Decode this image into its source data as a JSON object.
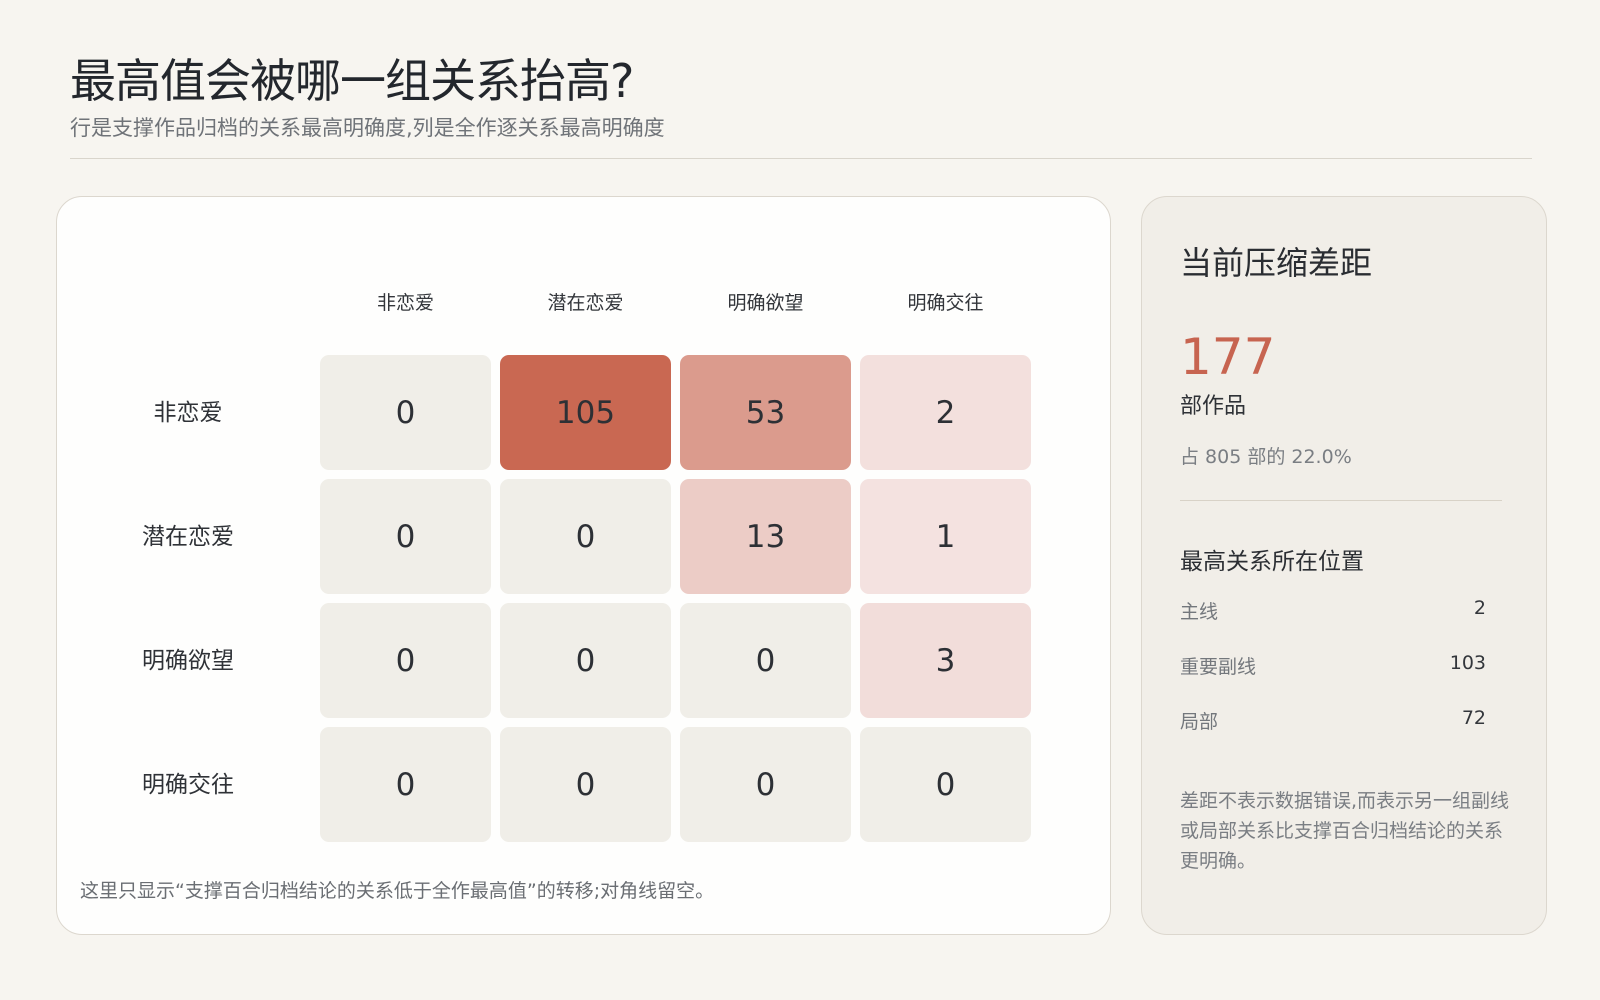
{
  "header": {
    "title": "最高值会被哪一组关系抬高?",
    "subtitle": "行是支撑作品归档的关系最高明确度,列是全作逐关系最高明确度"
  },
  "chart_data": {
    "type": "heatmap",
    "rows": [
      "非恋爱",
      "潜在恋爱",
      "明确欲望",
      "明确交往"
    ],
    "columns": [
      "非恋爱",
      "潜在恋爱",
      "明确欲望",
      "明确交往"
    ],
    "values": [
      [
        0,
        105,
        53,
        2
      ],
      [
        0,
        0,
        13,
        1
      ],
      [
        0,
        0,
        0,
        3
      ],
      [
        0,
        0,
        0,
        0
      ]
    ],
    "color_scale": {
      "zero": "#f0eee8",
      "low": "#f5e6e4",
      "high": "#c96852"
    },
    "max_value": 105
  },
  "footnote": "这里只显示“支撑百合归档结论的关系低于全作最高值”的转移;对角线留空。",
  "side": {
    "title": "当前压缩差距",
    "count": "177",
    "count_unit": "部作品",
    "share": "占 805 部的 22.0%",
    "position_title": "最高关系所在位置",
    "positions": [
      {
        "label": "主线",
        "value": "2"
      },
      {
        "label": "重要副线",
        "value": "103"
      },
      {
        "label": "局部",
        "value": "72"
      }
    ],
    "note": "差距不表示数据错误,而表示另一组副线或局部关系比支撑百合归档结论的关系更明确。"
  }
}
